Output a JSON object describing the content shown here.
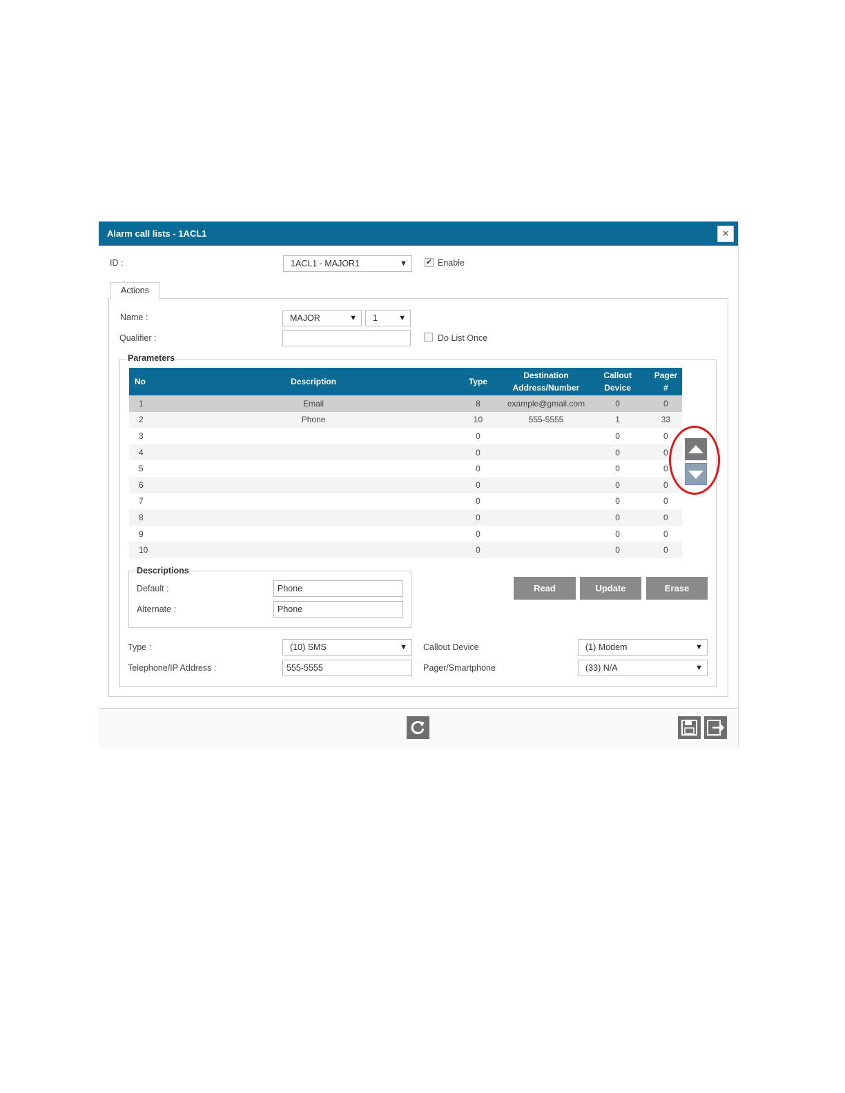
{
  "dialog": {
    "title": "Alarm call lists - 1ACL1",
    "close_label": "×"
  },
  "id_row": {
    "label": "ID :",
    "value": "1ACL1 - MAJOR1",
    "enable_label": "Enable",
    "enable_checked": true
  },
  "tabs": [
    {
      "label": "Actions"
    }
  ],
  "name_row": {
    "label": "Name :",
    "name_value": "MAJOR",
    "index_value": "1"
  },
  "qualifier_row": {
    "label": "Qualifier :",
    "value": "",
    "do_list_once_label": "Do List Once",
    "do_list_once_checked": false
  },
  "parameters": {
    "legend": "Parameters",
    "columns": [
      "No",
      "Description",
      "Type",
      "Destination Address/Number",
      "Callout Device",
      "Pager #"
    ],
    "header_lines": {
      "dest_1": "Destination",
      "dest_2": "Address/Number",
      "callout_1": "Callout",
      "callout_2": "Device",
      "pager_1": "Pager",
      "pager_2": "#"
    },
    "rows": [
      {
        "no": "1",
        "description": "Email",
        "type": "8",
        "destination": "example@gmail.com",
        "callout": "0",
        "pager": "0"
      },
      {
        "no": "2",
        "description": "Phone",
        "type": "10",
        "destination": "555-5555",
        "callout": "1",
        "pager": "33"
      },
      {
        "no": "3",
        "description": "",
        "type": "0",
        "destination": "",
        "callout": "0",
        "pager": "0"
      },
      {
        "no": "4",
        "description": "",
        "type": "0",
        "destination": "",
        "callout": "0",
        "pager": "0"
      },
      {
        "no": "5",
        "description": "",
        "type": "0",
        "destination": "",
        "callout": "0",
        "pager": "0"
      },
      {
        "no": "6",
        "description": "",
        "type": "0",
        "destination": "",
        "callout": "0",
        "pager": "0"
      },
      {
        "no": "7",
        "description": "",
        "type": "0",
        "destination": "",
        "callout": "0",
        "pager": "0"
      },
      {
        "no": "8",
        "description": "",
        "type": "0",
        "destination": "",
        "callout": "0",
        "pager": "0"
      },
      {
        "no": "9",
        "description": "",
        "type": "0",
        "destination": "",
        "callout": "0",
        "pager": "0"
      },
      {
        "no": "10",
        "description": "",
        "type": "0",
        "destination": "",
        "callout": "0",
        "pager": "0"
      }
    ]
  },
  "descriptions": {
    "legend": "Descriptions",
    "default_label": "Default :",
    "default_value": "Phone",
    "alternate_label": "Alternate :",
    "alternate_value": "Phone"
  },
  "actions": {
    "read": "Read",
    "update": "Update",
    "erase": "Erase"
  },
  "details": {
    "type_label": "Type :",
    "type_value": "(10) SMS",
    "address_label": "Telephone/IP Address :",
    "address_value": "555-5555",
    "callout_label": "Callout Device",
    "callout_value": "(1) Modem",
    "pager_label": "Pager/Smartphone",
    "pager_value": "(33) N/A"
  },
  "colors": {
    "header": "#0b6b94",
    "button": "#8a8a8a",
    "highlight_ring": "#e01818"
  },
  "icons": [
    "close-icon",
    "checkbox-icon",
    "arrow-up-icon",
    "arrow-down-icon",
    "refresh-icon",
    "save-icon",
    "exit-icon",
    "dropdown-caret-icon"
  ]
}
